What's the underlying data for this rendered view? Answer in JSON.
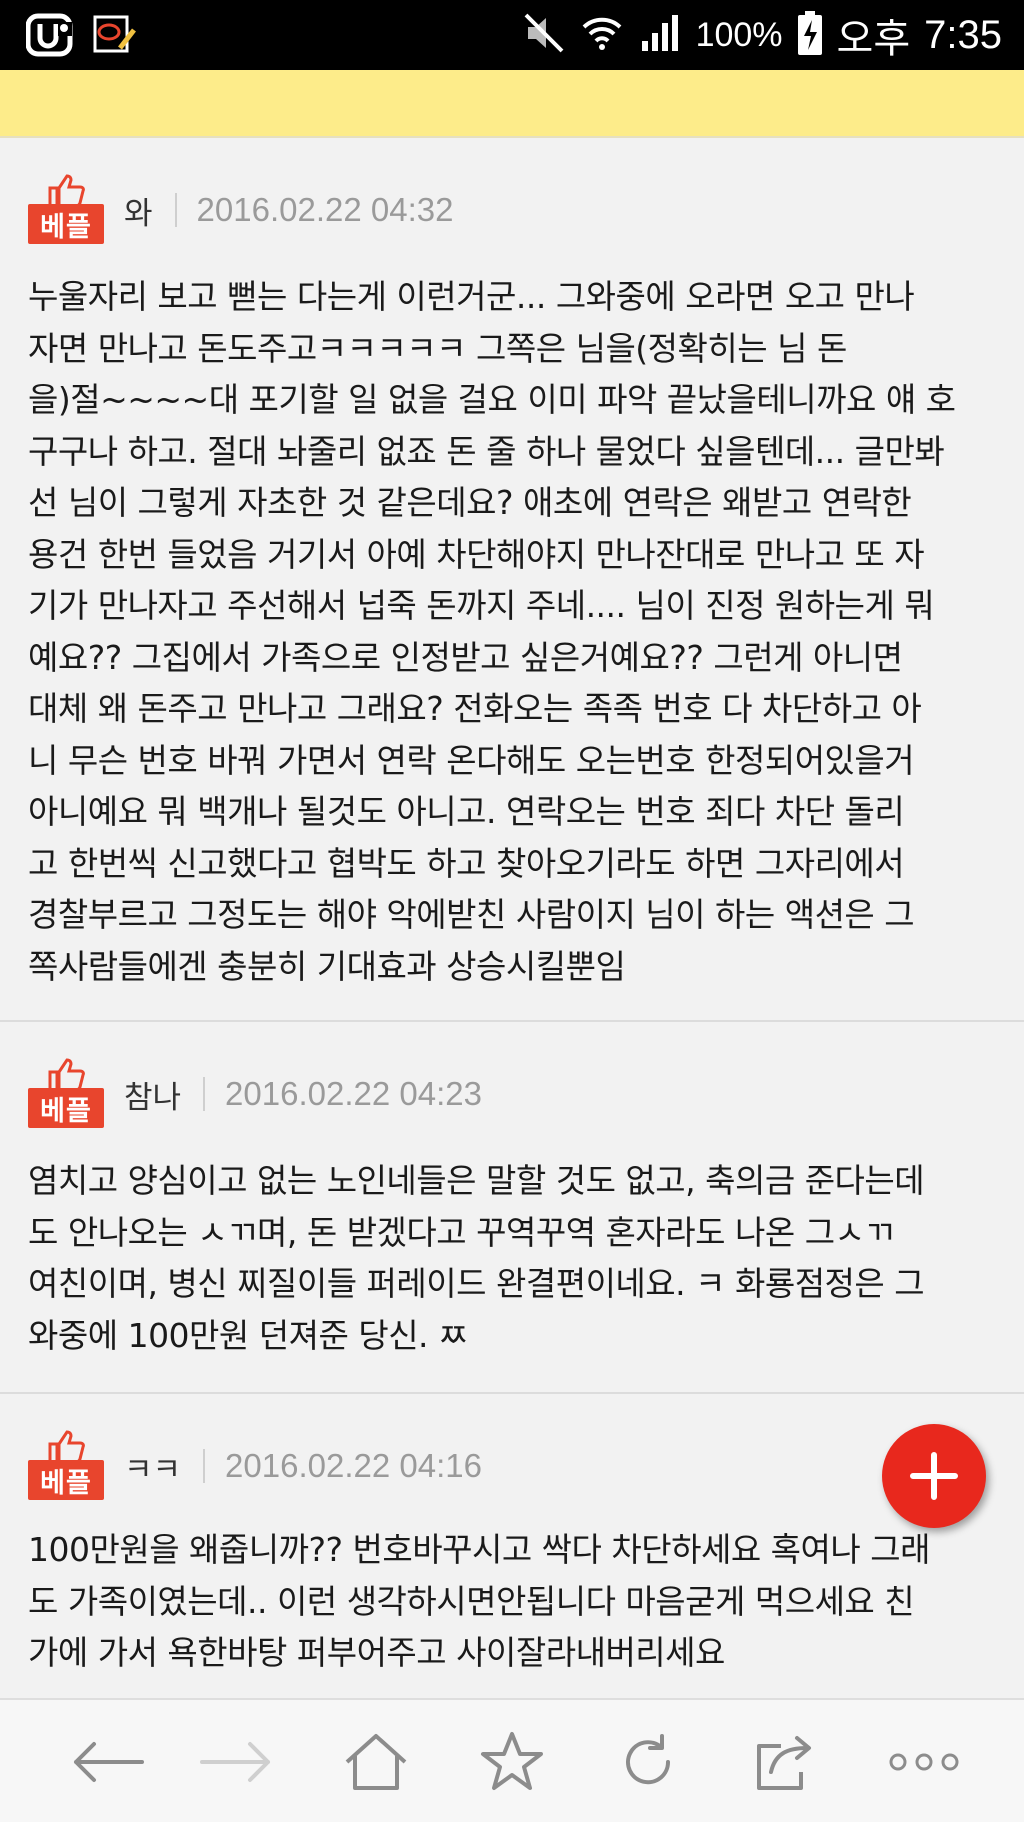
{
  "status_bar": {
    "battery_percent": "100%",
    "am_pm": "오후",
    "time": "7:35",
    "icons": [
      "carrier-logo-icon",
      "memo-app-icon",
      "mute-icon",
      "wifi-icon",
      "signal-icon",
      "battery-charging-icon"
    ]
  },
  "best_badge_label": "베플",
  "comments": [
    {
      "author": "와",
      "date": "2016.02.22 04:32",
      "lines": [
        "누울자리 보고 뻗는 다는게 이런거군... 그와중에 오라면 오고 만나",
        "자면 만나고 돈도주고ㅋㅋㅋㅋㅋ 그쪽은 님을(정확히는 님 돈",
        "을)절~~~~대 포기할 일 없을 걸요 이미 파악 끝났을테니까요 얘 호",
        "구구나 하고. 절대 놔줄리 없죠 돈 줄 하나 물었다 싶을텐데... 글만봐",
        "선 님이 그렇게 자초한 것 같은데요? 애초에 연락은 왜받고 연락한",
        "용건 한번 들었음 거기서 아예 차단해야지 만나잔대로 만나고 또 자",
        "기가 만나자고 주선해서 넙죽 돈까지 주네.... 님이 진정 원하는게 뭐",
        "예요?? 그집에서 가족으로 인정받고 싶은거예요?? 그런게 아니면",
        "대체 왜 돈주고 만나고 그래요? 전화오는 족족 번호 다 차단하고 아",
        "니 무슨 번호 바꿔 가면서 연락 온다해도 오는번호 한정되어있을거",
        "아니예요 뭐 백개나 될것도 아니고. 연락오는 번호 죄다 차단 돌리",
        "고 한번씩 신고했다고 협박도 하고 찾아오기라도 하면 그자리에서",
        "경찰부르고 그정도는 해야 악에받친 사람이지 님이 하는 액션은 그",
        "쪽사람들에겐 충분히 기대효과 상승시킬뿐임"
      ]
    },
    {
      "author": "참나",
      "date": "2016.02.22 04:23",
      "lines": [
        "염치고 양심이고 없는 노인네들은 말할 것도 없고, 축의금 준다는데",
        "도 안나오는 ㅅㄲ며, 돈 받겠다고 꾸역꾸역 혼자라도 나온 그ㅅㄲ",
        "여친이며, 병신 찌질이들 퍼레이드 완결편이네요. ㅋ 화룡점정은 그",
        "와중에 100만원 던져준 당신. ㅉ"
      ]
    },
    {
      "author": "ㅋㅋ",
      "date": "2016.02.22 04:16",
      "lines": [
        "100만원을 왜줍니까?? 번호바꾸시고 싹다 차단하세요 혹여나 그래",
        "도 가족이였는데.. 이런 생각하시면안됩니다 마음굳게 먹으세요 친",
        "가에 가서 욕한바탕 퍼부어주고 사이잘라내버리세요"
      ]
    }
  ],
  "fab": {
    "icon": "plus-icon"
  },
  "bottom_nav": {
    "items": [
      "back-arrow-icon",
      "forward-arrow-icon",
      "home-icon",
      "star-icon",
      "refresh-icon",
      "share-icon",
      "more-icon"
    ]
  }
}
